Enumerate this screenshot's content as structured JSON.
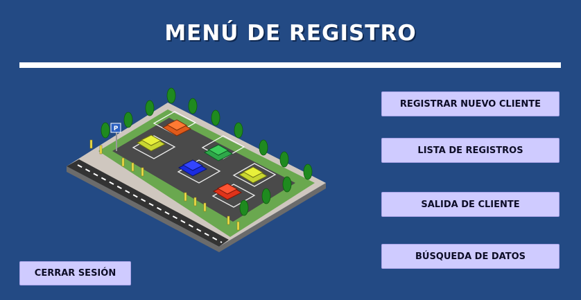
{
  "header": {
    "title": "MENÚ DE REGISTRO"
  },
  "menu": {
    "register_new_client": "REGISTRAR NUEVO CLIENTE",
    "records_list": "LISTA DE REGISTROS",
    "client_exit": "SALIDA DE CLIENTE",
    "data_search": "BÚSQUEDA DE DATOS"
  },
  "footer": {
    "logout": "CERRAR SESIÓN"
  },
  "illustration": {
    "parking_sign": "P",
    "icon": "parking-lot-illustration"
  },
  "colors": {
    "background": "#234a84",
    "button": "#cfcbff",
    "title": "#ffffff"
  }
}
